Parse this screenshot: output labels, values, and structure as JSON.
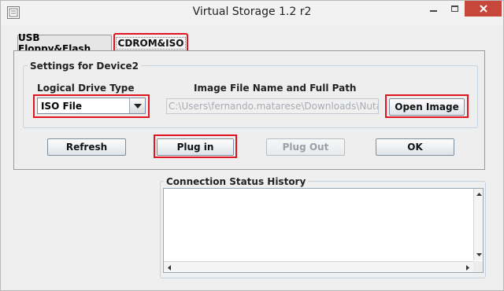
{
  "window": {
    "title": "Virtual Storage 1.2 r2"
  },
  "tabs": [
    {
      "label": "USB Floppy&Flash",
      "selected": false
    },
    {
      "label": "CDROM&ISO",
      "selected": true
    }
  ],
  "settings": {
    "group_title": "Settings for Device2",
    "drive_type_label": "Logical Drive Type",
    "drive_type_value": "ISO File",
    "image_path_label": "Image File Name and Full Path",
    "image_path_value": "C:\\Users\\fernando.matarese\\Downloads\\Nutani",
    "open_image_label": "Open Image"
  },
  "actions": {
    "refresh_label": "Refresh",
    "plug_in_label": "Plug in",
    "plug_out_label": "Plug Out",
    "ok_label": "OK"
  },
  "status": {
    "title": "Connection Status History"
  },
  "colors": {
    "highlight": "#e0151f",
    "close_button": "#c7483a"
  }
}
